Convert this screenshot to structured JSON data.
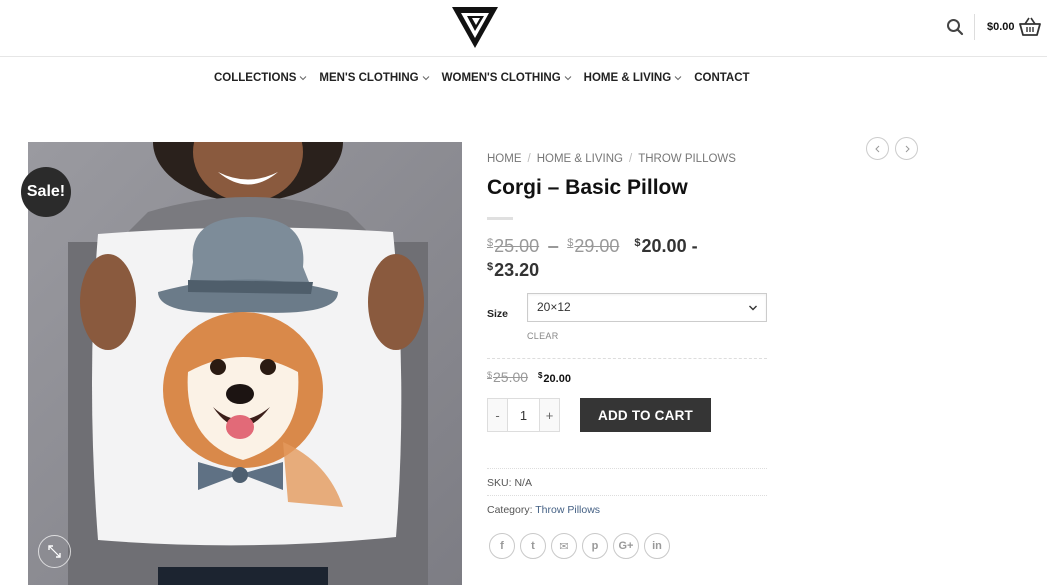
{
  "header": {
    "cart_total": "$0.00"
  },
  "nav": {
    "items": [
      {
        "label": "COLLECTIONS",
        "has_dropdown": true
      },
      {
        "label": "MEN'S CLOTHING",
        "has_dropdown": true
      },
      {
        "label": "WOMEN'S CLOTHING",
        "has_dropdown": true
      },
      {
        "label": "HOME & LIVING",
        "has_dropdown": true
      },
      {
        "label": "CONTACT",
        "has_dropdown": false
      }
    ]
  },
  "product": {
    "sale_badge": "Sale!",
    "breadcrumb": [
      "HOME",
      "HOME & LIVING",
      "THROW PILLOWS"
    ],
    "breadcrumb_sep": "/",
    "title": "Corgi – Basic Pillow",
    "price_range": {
      "currency": "$",
      "old_min": "25.00",
      "old_max": "29.00",
      "new_min": "20.00",
      "new_max": "23.20",
      "range_sep": "–",
      "new_sep": "-"
    },
    "size": {
      "label": "Size",
      "selected": "20×12",
      "clear_label": "CLEAR"
    },
    "variation_price": {
      "old": "25.00",
      "new": "20.00"
    },
    "quantity": {
      "minus": "-",
      "value": "1",
      "plus": "+"
    },
    "add_to_cart_label": "ADD TO CART",
    "sku_label": "SKU:",
    "sku_value": "N/A",
    "category_label": "Category:",
    "category_value": "Throw Pillows",
    "share_icons": [
      "facebook-icon",
      "twitter-icon",
      "email-icon",
      "pinterest-icon",
      "google-plus-icon",
      "linkedin-icon"
    ],
    "share_glyphs": [
      "f",
      "t",
      "✉",
      "p",
      "G+",
      "in"
    ]
  },
  "colors": {
    "accent_link": "#446084",
    "button_dark": "#353535",
    "sale_badge": "#2b2b2b"
  }
}
